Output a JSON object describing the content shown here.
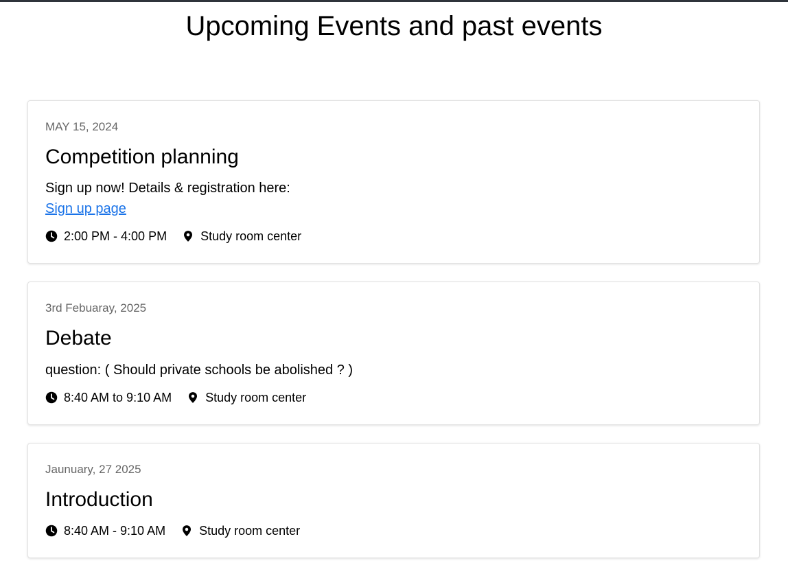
{
  "page": {
    "title": "Upcoming Events and past events"
  },
  "events": [
    {
      "date": "MAY 15, 2024",
      "title": "Competition planning",
      "description": "Sign up now! Details & registration here:",
      "link_label": "Sign up page",
      "time": "2:00 PM - 4:00 PM",
      "location": "Study room center"
    },
    {
      "date": "3rd Febuaray, 2025",
      "title": "Debate",
      "description": "question: ( Should private schools be abolished ? )",
      "time": "8:40 AM to 9:10 AM",
      "location": "Study room center"
    },
    {
      "date": "Jaunuary, 27 2025",
      "title": "Introduction",
      "time": "8:40 AM - 9:10 AM",
      "location": "Study room center"
    }
  ],
  "icons": {
    "time": "clock-icon",
    "location": "map-pin-icon"
  },
  "colors": {
    "link": "#1a73e8",
    "date_text": "#666666",
    "top_border": "#2f343b"
  }
}
